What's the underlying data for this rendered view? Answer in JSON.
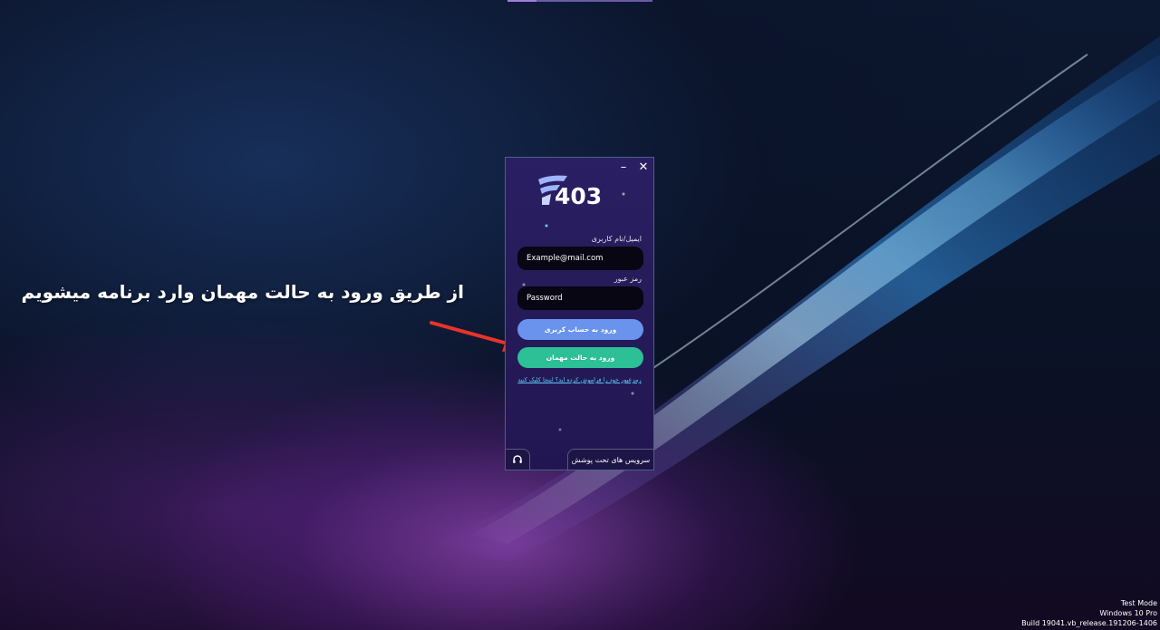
{
  "annotation": {
    "caption": "از طریق ورود به حالت مهمان وارد برنامه میشویم"
  },
  "app": {
    "logo_text": "403",
    "window_controls": {
      "minimize": "–",
      "close": "✕"
    },
    "email_label": "ایمیل/نام کاربری",
    "email_value": "Example@mail.com",
    "password_label": "رمز عبور",
    "password_value": "Password",
    "login_button": "ورود به حساب کربری",
    "guest_button": "ورود به حالت مهمان",
    "forgot_link": "رمزعبور خود را فراموش کرده اید؟ اینجا کلیک کنید",
    "services_button": "سرویس های تحت پوشش",
    "support_icon": "headset-icon"
  },
  "watermark": {
    "line1": "Test Mode",
    "line2": "Windows 10 Pro",
    "line3": "Build 19041.vb_release.191206-1406"
  },
  "colors": {
    "login_button": "#6a93ee",
    "guest_button": "#2dbf96",
    "window_bg": "#2a1f63",
    "link": "#5cc8f4",
    "arrow": "#e8342a"
  }
}
